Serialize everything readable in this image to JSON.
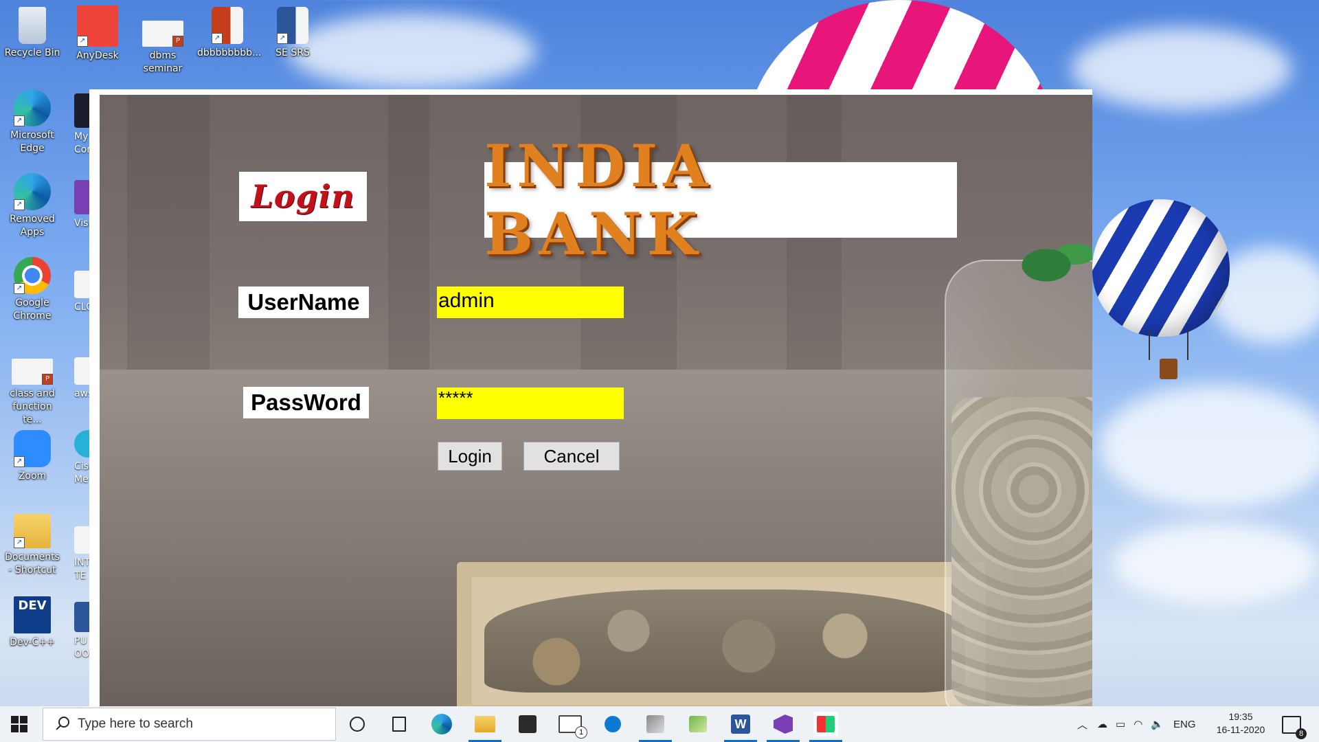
{
  "desktop": {
    "icons": [
      {
        "label": "Recycle Bin"
      },
      {
        "label": "AnyDesk"
      },
      {
        "label": "dbms seminar"
      },
      {
        "label": "dbbbbbbbb..."
      },
      {
        "label": "SE SRS"
      },
      {
        "label": "Microsoft Edge"
      },
      {
        "label": "Removed Apps"
      },
      {
        "label": "Google Chrome"
      },
      {
        "label": "class and function te..."
      },
      {
        "label": "Zoom"
      },
      {
        "label": "Documents - Shortcut"
      },
      {
        "label": "Dev-C++"
      }
    ],
    "partial_labels": [
      "My Cor",
      "Visua",
      "CLOU",
      "aws",
      "Cisco Me",
      "INTE TE",
      "PU OOPS"
    ]
  },
  "app": {
    "login_title": "Login",
    "bank_title": "INDIA BANK",
    "username_label": "UserName",
    "username_value": "admin",
    "password_label": "PassWord",
    "password_value": "*****",
    "login_button": "Login",
    "cancel_button": "Cancel"
  },
  "taskbar": {
    "search_placeholder": "Type here to search",
    "language": "ENG",
    "time": "19:35",
    "date": "16-11-2020",
    "mail_badge": "1",
    "notification_count": "8"
  }
}
